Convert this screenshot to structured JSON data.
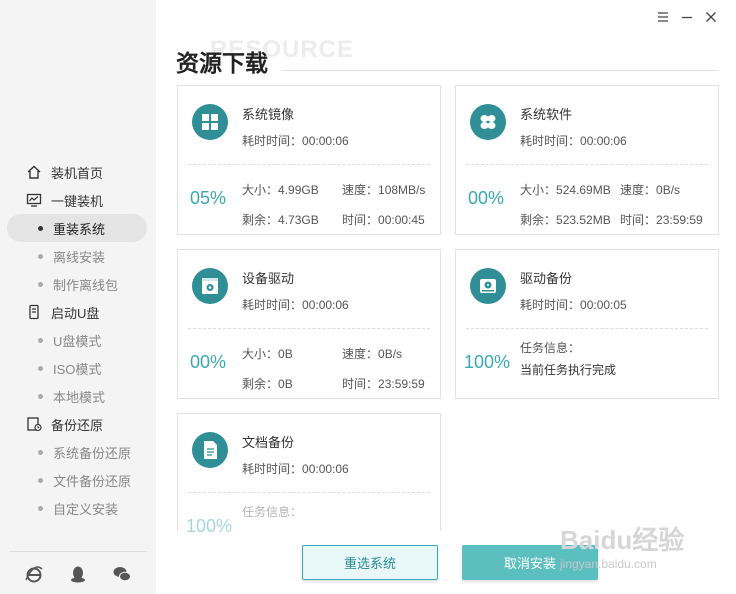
{
  "header": {
    "title": "资源下载",
    "watermark": "RESOURCE"
  },
  "sidebar": {
    "groups": [
      {
        "label": "装机首页",
        "icon": "home-icon",
        "items": []
      },
      {
        "label": "一键装机",
        "icon": "monitor-icon",
        "items": [
          {
            "label": "重装系统",
            "active": true
          },
          {
            "label": "离线安装"
          },
          {
            "label": "制作离线包"
          }
        ]
      },
      {
        "label": "启动U盘",
        "icon": "usb-icon",
        "items": [
          {
            "label": "U盘模式"
          },
          {
            "label": "ISO模式"
          },
          {
            "label": "本地模式"
          }
        ]
      },
      {
        "label": "备份还原",
        "icon": "backup-icon",
        "items": [
          {
            "label": "系统备份还原"
          },
          {
            "label": "文件备份还原"
          },
          {
            "label": "自定义安装"
          }
        ]
      }
    ],
    "footer_icons": [
      "ie-browser-icon",
      "qq-penguin-icon",
      "wechat-icon"
    ]
  },
  "cards": [
    {
      "name": "系统镜像",
      "icon": "windows-image-icon",
      "time_label": "耗时时间：",
      "time": "00:00:06",
      "percent": "05%",
      "size_label": "大小：",
      "size": "4.99GB",
      "speed_label": "速度：",
      "speed": "108MB/s",
      "remain_label": "剩余：",
      "remain": "4.73GB",
      "eta_label": "时间：",
      "eta": "00:00:45"
    },
    {
      "name": "系统软件",
      "icon": "software-icon",
      "time_label": "耗时时间：",
      "time": "00:00:06",
      "percent": "00%",
      "size_label": "大小：",
      "size": "524.69MB",
      "speed_label": "速度：",
      "speed": "0B/s",
      "remain_label": "剩余：",
      "remain": "523.52MB",
      "eta_label": "时间：",
      "eta": "23:59:59"
    },
    {
      "name": "设备驱动",
      "icon": "driver-icon",
      "time_label": "耗时时间：",
      "time": "00:00:06",
      "percent": "00%",
      "size_label": "大小：",
      "size": "0B",
      "speed_label": "速度：",
      "speed": "0B/s",
      "remain_label": "剩余：",
      "remain": "0B",
      "eta_label": "时间：",
      "eta": "23:59:59"
    },
    {
      "name": "驱动备份",
      "icon": "drive-backup-icon",
      "time_label": "耗时时间：",
      "time": "00:00:05",
      "percent": "100%",
      "info_label": "任务信息：",
      "info": "当前任务执行完成"
    },
    {
      "name": "文档备份",
      "icon": "document-backup-icon",
      "time_label": "耗时时间：",
      "time": "00:00:06",
      "percent": "100%",
      "info_label": "任务信息："
    }
  ],
  "buttons": {
    "reselect": "重选系统",
    "cancel": "取消安装"
  },
  "brand_watermark": {
    "logo": "Baidu经验",
    "url": "jingyan.baidu.com"
  },
  "colors": {
    "accent": "#3aa8b2",
    "icon_bg": "#2f8e96",
    "cancel_button": "#5bbfc0"
  }
}
